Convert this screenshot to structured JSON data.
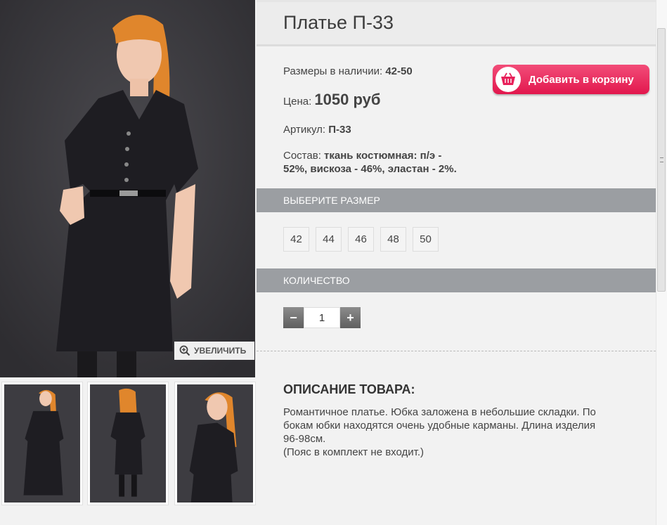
{
  "product": {
    "title": "Платье П-33",
    "sizes_available_label": "Размеры в наличии:",
    "sizes_available_value": "42-50",
    "price_label": "Цена:",
    "price_value": "1050 руб",
    "article_label": "Артикул:",
    "article_value": "П-33",
    "composition_label": "Состав:",
    "composition_line1": "ткань костюмная: п/э -",
    "composition_line2": "52%, вискоза - 46%, эластан - 2%."
  },
  "cart_button": {
    "label": "Добавить в корзину",
    "icon": "basket-icon"
  },
  "zoom_button": {
    "label": "УВЕЛИЧИТЬ",
    "icon": "zoom-in-icon"
  },
  "size_section": {
    "title": "ВЫБЕРИТЕ РАЗМЕР",
    "options": [
      "42",
      "44",
      "46",
      "48",
      "50"
    ]
  },
  "quantity_section": {
    "title": "КОЛИЧЕСТВО",
    "minus": "−",
    "plus": "+",
    "value": "1"
  },
  "description": {
    "title": "ОПИСАНИЕ ТОВАРА:",
    "line1": "Романтичное платье. Юбка заложена в небольшие складки. По",
    "line2": "бокам юбки находятся очень удобные карманы. Длина изделия",
    "line3": "96-98см.",
    "line4": "(Пояс в комплект не входит.)"
  },
  "colors": {
    "accent_pink": "#e8205a",
    "section_bar": "#9b9ea2",
    "photo_bg": "#3b3a3e"
  }
}
